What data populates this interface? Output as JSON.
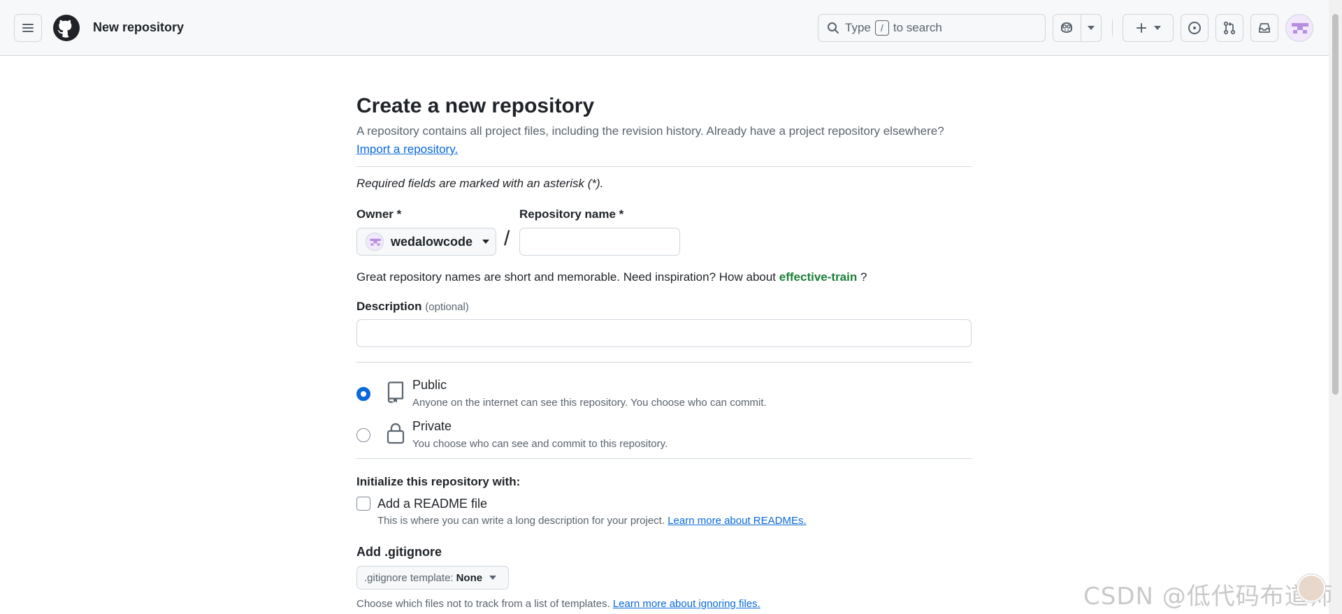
{
  "header": {
    "context_title": "New repository",
    "search": {
      "prefix": "Type",
      "key": "/",
      "suffix": "to search"
    }
  },
  "form": {
    "title": "Create a new repository",
    "subtitle": "A repository contains all project files, including the revision history. Already have a project repository elsewhere?",
    "import_link": "Import a repository.",
    "required_note": "Required fields are marked with an asterisk (*).",
    "owner_label": "Owner *",
    "owner_value": "wedalowcode",
    "slash": "/",
    "repo_name_label": "Repository name *",
    "repo_name_value": "",
    "name_hint_prefix": "Great repository names are short and memorable. Need inspiration? How about",
    "name_suggestion": "effective-train",
    "name_hint_suffix": "?",
    "description_label": "Description",
    "description_optional": "(optional)",
    "description_value": "",
    "visibility": {
      "public": {
        "title": "Public",
        "description": "Anyone on the internet can see this repository. You choose who can commit.",
        "selected": true
      },
      "private": {
        "title": "Private",
        "description": "You choose who can see and commit to this repository.",
        "selected": false
      }
    },
    "init_heading": "Initialize this repository with:",
    "readme": {
      "label": "Add a README file",
      "description": "This is where you can write a long description for your project.",
      "link": "Learn more about READMEs.",
      "checked": false
    },
    "gitignore": {
      "heading": "Add .gitignore",
      "select_prefix": ".gitignore template:",
      "select_value": "None",
      "description": "Choose which files not to track from a list of templates.",
      "link": "Learn more about ignoring files."
    }
  },
  "watermark": "CSDN @低代码布道师",
  "colors": {
    "accent": "#0969da",
    "success": "#1a7f37",
    "header_bg": "#f6f8fa",
    "border": "#d0d7de",
    "muted_text": "#59636e"
  },
  "icons": {
    "menu": "hamburger-icon",
    "logo": "github-mark-icon",
    "search": "search-icon",
    "copilot": "copilot-icon",
    "create": "plus-icon",
    "issues": "issue-opened-icon",
    "pulls": "git-pull-request-icon",
    "inbox": "inbox-icon",
    "public": "repo-icon",
    "private": "lock-icon"
  }
}
